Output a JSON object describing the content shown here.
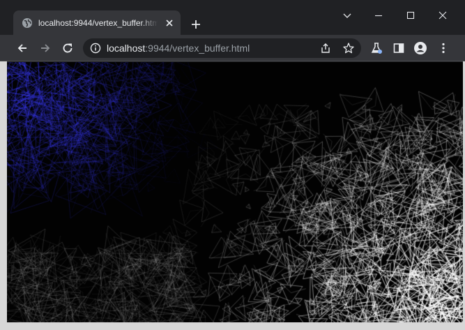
{
  "tab": {
    "title": "localhost:9944/vertex_buffer.html"
  },
  "omnibox": {
    "host": "localhost",
    "rest": ":9944/vertex_buffer.html"
  },
  "icons": {
    "favicon": "globe-icon",
    "tab_close": "close-icon",
    "new_tab": "plus-icon",
    "tab_search": "chevron-down-icon",
    "minimize": "minimize-icon",
    "maximize": "maximize-icon",
    "close_window": "close-icon",
    "back": "arrow-left-icon",
    "forward": "arrow-right-icon",
    "reload": "reload-icon",
    "site_info": "info-icon",
    "share": "share-icon",
    "bookmark": "star-icon",
    "labs": "flask-icon",
    "side_panel": "side-panel-icon",
    "profile": "profile-icon",
    "menu": "kebab-menu-icon"
  },
  "colors": {
    "tab_strip": "#202124",
    "toolbar": "#35363a",
    "canvas_bg": "#020202",
    "blue_lines": "#3a3aff",
    "white_lines": "#ffffff"
  }
}
